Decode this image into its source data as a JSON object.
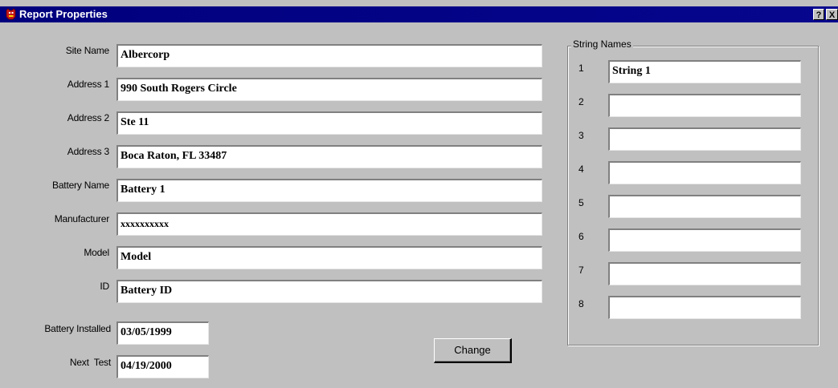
{
  "window": {
    "title": "Report Properties",
    "help_label": "?",
    "close_label": "X"
  },
  "fields": {
    "site_name": {
      "label": "Site Name",
      "value": "Albercorp"
    },
    "address1": {
      "label": "Address 1",
      "value": "990 South Rogers Circle"
    },
    "address2": {
      "label": "Address 2",
      "value": "Ste 11"
    },
    "address3": {
      "label": "Address 3",
      "value": "Boca Raton, FL 33487"
    },
    "battery_name": {
      "label": "Battery Name",
      "value": "Battery 1"
    },
    "manufacturer": {
      "label": "Manufacturer",
      "value": "xxxxxxxxxx"
    },
    "model": {
      "label": "Model",
      "value": "Model"
    },
    "id": {
      "label": "ID",
      "value": "Battery ID"
    },
    "battery_installed": {
      "label": "Battery Installed",
      "value": "03/05/1999"
    },
    "next_test": {
      "label": "Next  Test",
      "value": "04/19/2000"
    }
  },
  "change_button": "Change",
  "string_names": {
    "title": "String Names",
    "items": [
      {
        "num": "1",
        "value": "String 1"
      },
      {
        "num": "2",
        "value": ""
      },
      {
        "num": "3",
        "value": ""
      },
      {
        "num": "4",
        "value": ""
      },
      {
        "num": "5",
        "value": ""
      },
      {
        "num": "6",
        "value": ""
      },
      {
        "num": "7",
        "value": ""
      },
      {
        "num": "8",
        "value": ""
      }
    ]
  }
}
